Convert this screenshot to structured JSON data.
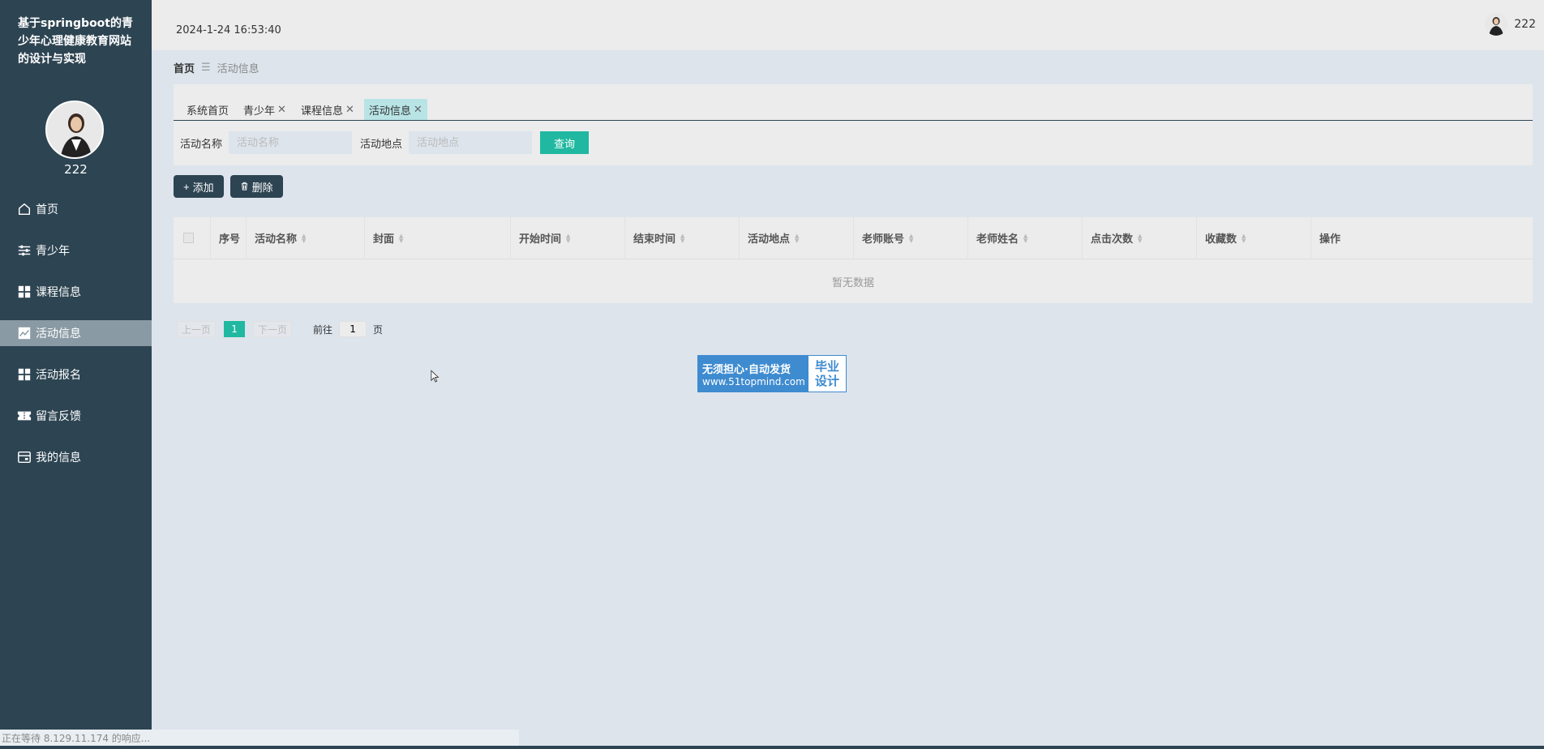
{
  "sidebar": {
    "site_title": "基于springboot的青少年心理健康教育网站的设计与实现",
    "username": "222",
    "items": [
      {
        "label": "首页",
        "icon": "home-icon"
      },
      {
        "label": "青少年",
        "icon": "sliders-icon"
      },
      {
        "label": "课程信息",
        "icon": "grid-icon"
      },
      {
        "label": "活动信息",
        "icon": "chart-icon",
        "active": true
      },
      {
        "label": "活动报名",
        "icon": "grid-icon"
      },
      {
        "label": "留言反馈",
        "icon": "ticket-icon"
      },
      {
        "label": "我的信息",
        "icon": "card-icon"
      }
    ]
  },
  "header": {
    "datetime": "2024-1-24 16:53:40",
    "username": "222"
  },
  "breadcrumb": {
    "home": "首页",
    "separator": "☰",
    "current": "活动信息"
  },
  "tabs": [
    {
      "label": "系统首页",
      "closable": false
    },
    {
      "label": "青少年",
      "closable": true
    },
    {
      "label": "课程信息",
      "closable": true
    },
    {
      "label": "活动信息",
      "closable": true,
      "active": true
    }
  ],
  "search": {
    "name_label": "活动名称",
    "name_placeholder": "活动名称",
    "location_label": "活动地点",
    "location_placeholder": "活动地点",
    "query_button": "查询"
  },
  "actions": {
    "add_label": "添加",
    "delete_label": "删除"
  },
  "table": {
    "columns": [
      "序号",
      "活动名称",
      "封面",
      "开始时间",
      "结束时间",
      "活动地点",
      "老师账号",
      "老师姓名",
      "点击次数",
      "收藏数",
      "操作"
    ],
    "empty_text": "暂无数据"
  },
  "pagination": {
    "prev": "上一页",
    "current_page": "1",
    "next": "下一页",
    "goto_label": "前往",
    "goto_value": "1",
    "page_suffix": "页"
  },
  "banner": {
    "line1": "无须担心·自动发货",
    "line2": "www.51topmind.com",
    "right1": "毕业",
    "right2": "设计"
  },
  "status": {
    "text": "正在等待 8.129.11.174 的响应..."
  },
  "colors": {
    "sidebar": "#2d4452",
    "accent": "#20b8a0",
    "active_tab": "#b8e4e6",
    "banner_blue": "#3e8bd0"
  }
}
